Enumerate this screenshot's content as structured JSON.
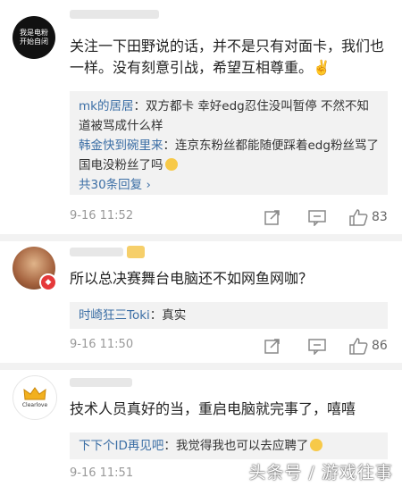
{
  "comments": [
    {
      "avatar_text": "我是电粉\n开始自闭",
      "text": "关注一下田野说的话，并不是只有对面卡，我们也一样。没有刻意引战，希望互相尊重。✌️",
      "replies": [
        {
          "user": "mk的居居",
          "text": "双方都卡 幸好edg忍住没叫暂停 不然不知道被骂成什么样"
        },
        {
          "user": "韩金快到碗里来",
          "text": "连京东粉丝都能随便踩着edg粉丝骂了 国电没粉丝了吗"
        }
      ],
      "more_label": "共30条回复",
      "time": "9-16 11:52",
      "likes": "83"
    },
    {
      "text": "所以总决赛舞台电脑还不如网鱼网咖？",
      "replies": [
        {
          "user": "时崎狂三Toki",
          "text": "真实"
        }
      ],
      "time": "9-16 11:50",
      "likes": "86"
    },
    {
      "avatar_text": "Clearlove",
      "text": "技术人员真好的当，重启电脑就完事了，嘻嘻",
      "replies": [
        {
          "user": "下下个ID再见吧",
          "text": "我觉得我也可以去应聘了"
        }
      ],
      "time": "9-16 11:51",
      "likes": ""
    }
  ],
  "watermark": "头条号 / 游戏往事",
  "colors": {
    "link": "#3b6ea5",
    "reply_bg": "#f2f2f2",
    "time": "#999999"
  },
  "icons": [
    "share-icon",
    "comment-icon",
    "like-icon",
    "crown-icon"
  ]
}
